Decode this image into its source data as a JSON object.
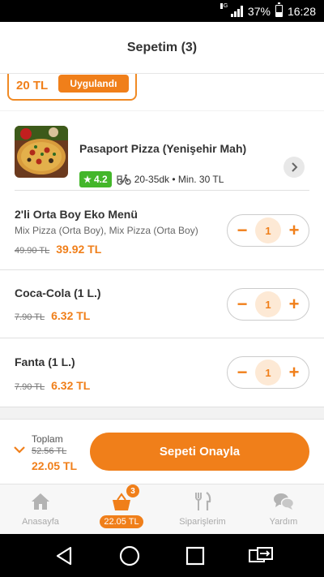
{
  "status_bar": {
    "network": "4G",
    "battery": "37%",
    "time": "16:28"
  },
  "header": {
    "title": "Sepetim (3)"
  },
  "coupon": {
    "amount": "20 TL",
    "status": "Uygulandı"
  },
  "restaurant": {
    "name": "Pasaport Pizza (Yenişehir Mah)",
    "rating": "4.2",
    "delivery": "20-35dk • Min. 30 TL"
  },
  "items": [
    {
      "name": "2'li Orta Boy Eko Menü",
      "description": "Mix Pizza (Orta Boy), Mix Pizza (Orta Boy)",
      "old_price": "49.90 TL",
      "price": "39.92 TL",
      "quantity": "1"
    },
    {
      "name": "Coca-Cola (1 L.)",
      "old_price": "7.90 TL",
      "price": "6.32 TL",
      "quantity": "1"
    },
    {
      "name": "Fanta (1 L.)",
      "old_price": "7.90 TL",
      "price": "6.32 TL",
      "quantity": "1"
    }
  ],
  "summary": {
    "label": "Toplam",
    "old_total": "52.56 TL",
    "total": "22.05 TL",
    "confirm_label": "Sepeti Onayla"
  },
  "nav": {
    "home": "Anasayfa",
    "cart_badge": "3",
    "cart_total": "22.05 TL",
    "orders": "Siparişlerim",
    "help": "Yardım"
  },
  "colors": {
    "accent": "#f07f1a",
    "rating": "#43b62a"
  }
}
